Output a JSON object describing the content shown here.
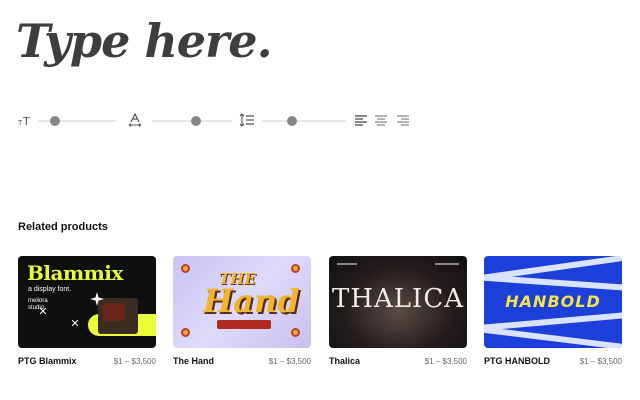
{
  "preview": {
    "text": "Type here."
  },
  "controls": {
    "font_size_icon": "text-size-icon",
    "letter_spacing_icon": "letter-spacing-icon",
    "line_height_icon": "line-height-icon",
    "font_size_level": 0.17,
    "letter_spacing_level": 0.56,
    "line_height_level": 0.34,
    "align_left_icon": "align-left-icon",
    "align_center_icon": "align-center-icon",
    "align_right_icon": "align-right-icon"
  },
  "related": {
    "title": "Related products",
    "products": [
      {
        "name": "PTG Blammix",
        "price": "$1 – $3,500",
        "thumb": {
          "logo": "Blammix",
          "sub": "a display font.",
          "studio": "meliora\nstudio"
        }
      },
      {
        "name": "The Hand",
        "price": "$1 – $3,500",
        "thumb": {
          "line1": "THE",
          "line2": "Hand"
        }
      },
      {
        "name": "Thalica",
        "price": "$1 – $3,500",
        "thumb": {
          "logo": "THALICA"
        }
      },
      {
        "name": "PTG HANBOLD",
        "price": "$1 – $3,500",
        "thumb": {
          "logo": "HANBOLD"
        }
      }
    ]
  }
}
